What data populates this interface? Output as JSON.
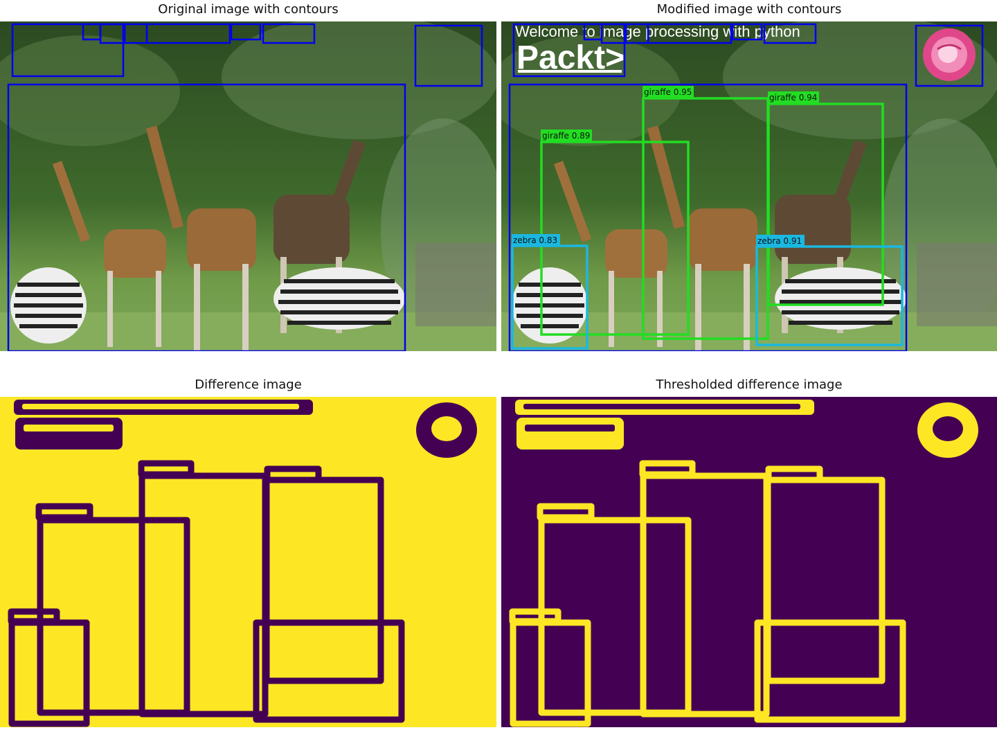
{
  "panels": {
    "original": {
      "title": "Original image with contours"
    },
    "modified": {
      "title": "Modified image with contours"
    },
    "difference": {
      "title": "Difference image"
    },
    "thresholded": {
      "title": "Thresholded difference image"
    }
  },
  "overlay": {
    "banner": "Welcome to image processing with python",
    "logo": "Packt>"
  },
  "detections": [
    {
      "label": "giraffe 0.95"
    },
    {
      "label": "giraffe 0.94"
    },
    {
      "label": "giraffe 0.89"
    },
    {
      "label": "zebra 0.83"
    },
    {
      "label": "zebra 0.91"
    }
  ],
  "colors": {
    "contour": "#0000ee",
    "giraffe_box": "#22dd22",
    "zebra_box": "#1ab8e0",
    "diff_bg": "#fde725",
    "diff_fg": "#440154"
  }
}
